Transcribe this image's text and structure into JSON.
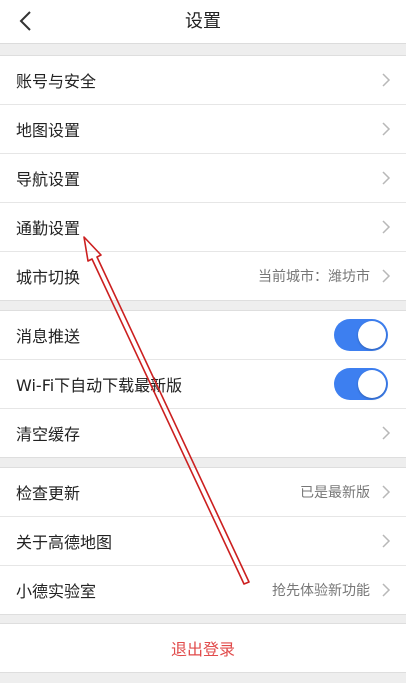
{
  "header": {
    "title": "设置",
    "back_icon": "chevron-left-icon"
  },
  "groups": [
    {
      "items": [
        {
          "label": "账号与安全",
          "value": ""
        },
        {
          "label": "地图设置",
          "value": ""
        },
        {
          "label": "导航设置",
          "value": ""
        },
        {
          "label": "通勤设置",
          "value": ""
        },
        {
          "label": "城市切换",
          "value": "当前城市：潍坊市"
        }
      ]
    },
    {
      "items": [
        {
          "label": "消息推送",
          "toggle": true
        },
        {
          "label": "Wi-Fi下自动下载最新版",
          "toggle": true
        },
        {
          "label": "清空缓存",
          "value": ""
        }
      ]
    },
    {
      "items": [
        {
          "label": "检查更新",
          "value": "已是最新版"
        },
        {
          "label": "关于高德地图",
          "value": ""
        },
        {
          "label": "小德实验室",
          "value": "抢先体验新功能"
        }
      ]
    }
  ],
  "logout": {
    "label": "退出登录"
  },
  "colors": {
    "accent": "#3d7ff0",
    "logout": "#e14b4b",
    "annotation": "#cc2020"
  }
}
